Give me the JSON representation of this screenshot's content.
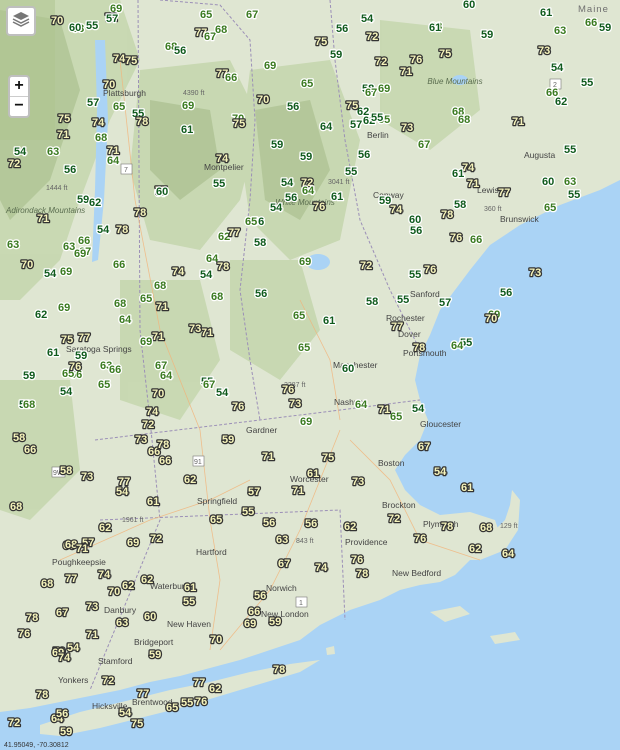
{
  "map": {
    "controls": {
      "zoom_in": "+",
      "zoom_out": "−",
      "layers_icon": "layers-icon"
    },
    "coord_readout": "41.95049, -70.30812",
    "states": [
      {
        "name": "Maine"
      }
    ],
    "cities": [
      {
        "name": "Plattsburgh"
      },
      {
        "name": "Montpelier"
      },
      {
        "name": "Berlin"
      },
      {
        "name": "Conway"
      },
      {
        "name": "Lewiston"
      },
      {
        "name": "Augusta"
      },
      {
        "name": "Brunswick"
      },
      {
        "name": "Sanford"
      },
      {
        "name": "Rochester"
      },
      {
        "name": "Dover"
      },
      {
        "name": "Portsmouth"
      },
      {
        "name": "Saratoga Springs"
      },
      {
        "name": "Manchester"
      },
      {
        "name": "Nashua"
      },
      {
        "name": "Gardner"
      },
      {
        "name": "Gloucester"
      },
      {
        "name": "Boston"
      },
      {
        "name": "Worcester"
      },
      {
        "name": "Springfield"
      },
      {
        "name": "Brockton"
      },
      {
        "name": "Plymouth"
      },
      {
        "name": "Providence"
      },
      {
        "name": "Poughkeepsie"
      },
      {
        "name": "Hartford"
      },
      {
        "name": "Waterbury"
      },
      {
        "name": "New Bedford"
      },
      {
        "name": "Danbury"
      },
      {
        "name": "New Haven"
      },
      {
        "name": "Norwich"
      },
      {
        "name": "New London"
      },
      {
        "name": "Bridgeport"
      },
      {
        "name": "Stamford"
      },
      {
        "name": "Yonkers"
      },
      {
        "name": "Hicksville"
      },
      {
        "name": "Brentwood"
      }
    ],
    "features": [
      {
        "name": "White Mountains"
      },
      {
        "name": "Blue Mountains"
      },
      {
        "name": "Adirondack Mountains"
      }
    ],
    "elevations": [
      "4390 ft",
      "3041 ft",
      "360 ft",
      "1444 ft",
      "2287 ft",
      "1961 ft",
      "843 ft",
      "129 ft"
    ],
    "routes": [
      "7",
      "2",
      "91",
      "9W",
      "1"
    ],
    "temperature_readings": [
      "65",
      "67",
      "69",
      "61",
      "60",
      "54",
      "68",
      "63",
      "74",
      "75",
      "66",
      "59",
      "71",
      "64",
      "70",
      "72",
      "73",
      "62",
      "55",
      "56",
      "58",
      "57",
      "76",
      "77",
      "78"
    ]
  },
  "colors": {
    "land": "#dfe6d2",
    "forest": "#c8d8b4",
    "mountain": "#b4c79c",
    "water": "#aad3f5",
    "temp_cool": "#0f5a1c",
    "temp_mid": "#3a7a20",
    "temp_warm": "#f6f4bb"
  }
}
